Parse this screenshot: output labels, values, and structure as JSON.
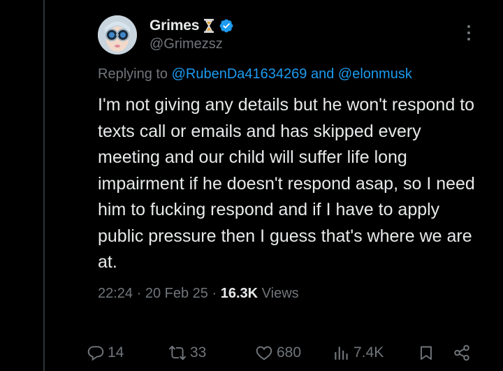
{
  "author": {
    "display_name": "Grimes",
    "handle": "@Grimezsz",
    "badge_emoji": "hourglass-icon",
    "verified": true
  },
  "replying": {
    "prefix": "Replying to",
    "mention1": "@RubenDa41634269",
    "conjunction": "and",
    "mention2": "@elonmusk"
  },
  "tweet": {
    "text": "I'm not giving any details but he won't respond to texts call or emails and has skipped every meeting and our child will suffer life long impairment if he doesn't respond asap, so I need him to fucking respond and if I have to apply public pressure then I guess that's where we are at."
  },
  "meta": {
    "time": "22:24",
    "separator": "·",
    "date": "20 Feb 25",
    "views_count": "16.3K",
    "views_label": "Views"
  },
  "actions": {
    "replies": "14",
    "retweets": "33",
    "likes": "680",
    "views": "7.4K"
  },
  "colors": {
    "background": "#000000",
    "text_primary": "#e7e9ea",
    "text_secondary": "#71767b",
    "accent": "#1d9bf0"
  }
}
